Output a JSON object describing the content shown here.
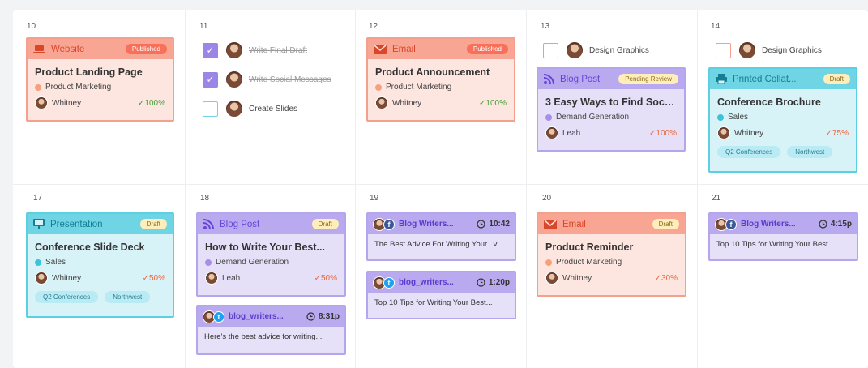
{
  "days": [
    "10",
    "11",
    "12",
    "13",
    "14",
    "17",
    "18",
    "19",
    "20",
    "21"
  ],
  "cards": {
    "c10": {
      "type": "Website",
      "status": "Published",
      "title": "Product Landing Page",
      "category": "Product Marketing",
      "owner": "Whitney",
      "progress": "✓100%"
    },
    "c12": {
      "type": "Email",
      "status": "Published",
      "title": "Product Announcement",
      "category": "Product Marketing",
      "owner": "Whitney",
      "progress": "✓100%"
    },
    "c13": {
      "type": "Blog Post",
      "status": "Pending Review",
      "title": "3 Easy Ways to Find Social...",
      "category": "Demand Generation",
      "owner": "Leah",
      "progress": "✓100%"
    },
    "c14": {
      "type": "Printed Collat...",
      "status": "Draft",
      "title": "Conference Brochure",
      "category": "Sales",
      "owner": "Whitney",
      "progress": "✓75%",
      "tags": [
        "Q2 Conferences",
        "Northwest"
      ]
    },
    "c17": {
      "type": "Presentation",
      "status": "Draft",
      "title": "Conference Slide Deck",
      "category": "Sales",
      "owner": "Whitney",
      "progress": "✓50%",
      "tags": [
        "Q2 Conferences",
        "Northwest"
      ]
    },
    "c18": {
      "type": "Blog Post",
      "status": "Draft",
      "title": "How to Write Your Best...",
      "category": "Demand Generation",
      "owner": "Leah",
      "progress": "✓50%"
    },
    "c20": {
      "type": "Email",
      "status": "Draft",
      "title": "Product Reminder",
      "category": "Product Marketing",
      "owner": "Whitney",
      "progress": "✓30%"
    }
  },
  "tasks": {
    "t11a": "Write Final Draft",
    "t11b": "Write Social Messages",
    "t11c": "Create Slides",
    "t13": "Design Graphics",
    "t14": "Design Graphics"
  },
  "social": {
    "s18": {
      "name": "blog_writers...",
      "time": "8:31p",
      "text": "Here's the best advice for writing..."
    },
    "s19a": {
      "name": "Blog Writers...",
      "time": "10:42",
      "text": "The Best Advice For Writing Your...v"
    },
    "s19b": {
      "name": "blog_writers...",
      "time": "1:20p",
      "text": "Top 10 Tips for Writing Your Best..."
    },
    "s21": {
      "name": "Blog Writers...",
      "time": "4:15p",
      "text": "Top 10 Tips for Writing Your Best..."
    }
  },
  "colors": {
    "website": "#f9a593",
    "blog": "#b9a9ee",
    "print": "#6fd4e4",
    "green": "#4a9f3a",
    "orange": "#e8683f"
  }
}
